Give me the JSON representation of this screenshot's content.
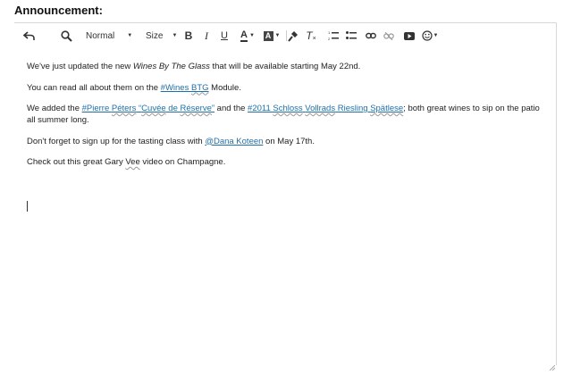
{
  "page": {
    "title": "Announcement:"
  },
  "toolbar": {
    "format_value": "Normal",
    "size_value": "Size",
    "bold_glyph": "B",
    "italic_glyph": "I",
    "underline_glyph": "U",
    "text_color_glyph": "A",
    "bg_color_glyph": "A",
    "clear_format_glyph": "T",
    "icons": [
      "undo-icon",
      "search-icon",
      "bold-icon",
      "italic-icon",
      "underline-icon",
      "text-color-icon",
      "background-color-icon",
      "format-painter-icon",
      "clear-format-icon",
      "ordered-list-icon",
      "bullet-list-icon",
      "link-icon",
      "unlink-icon",
      "video-icon",
      "emoji-icon"
    ]
  },
  "content": {
    "p1": {
      "before": "We've just updated the new ",
      "italic": "Wines By The Glass",
      "after": " that will be available starting May 22nd."
    },
    "p2": {
      "before": "You can read all about them on the ",
      "link_prefix": "#Wines ",
      "link_wavy": "BTG",
      "after": " Module."
    },
    "p3": {
      "before": "We added the ",
      "link1_a": "#Pierre ",
      "link1_w1": "Péters",
      "link1_b": " “",
      "link1_w2": "Cuvée",
      "link1_c": " de ",
      "link1_w3": "Réserve",
      "link1_d": "”",
      "middle": " and the ",
      "link2_a": "#2011 ",
      "link2_w1": "Schloss",
      "link2_b": " ",
      "link2_w2": "Vollrads",
      "link2_c": " Riesling ",
      "link2_w3": "Spätlese",
      "after": "; both great wines to sip on the patio all summer long."
    },
    "p4": {
      "before": "Don't forget to sign up for the tasting class with ",
      "link": "@Dana Koteen",
      "after": " on May 17th."
    },
    "p5": {
      "before": "Check out this great Gary ",
      "wavy": "Vee",
      "after": " video on Champagne."
    }
  },
  "colors": {
    "link": "#1f6fa8",
    "text": "#222222",
    "border": "#d8d8d8"
  }
}
